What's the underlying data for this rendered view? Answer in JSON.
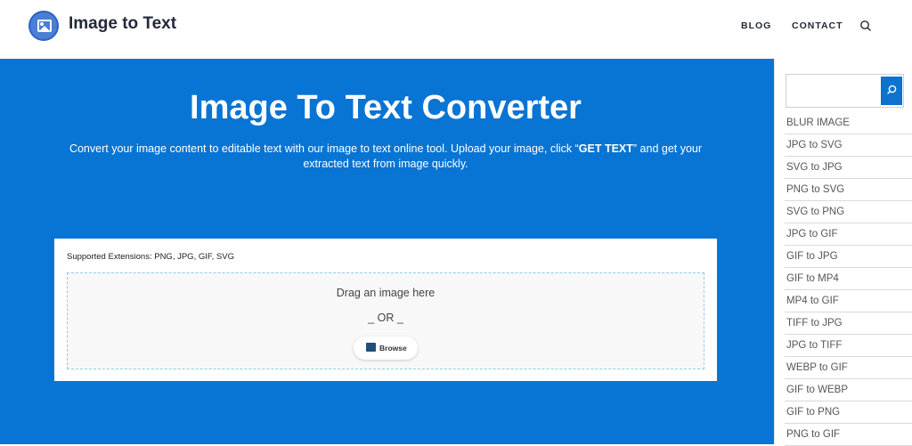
{
  "header": {
    "logo_text": "Image to Text",
    "nav": {
      "blog": "BLOG",
      "contact": "CONTACT"
    }
  },
  "hero": {
    "title": "Image To Text Converter",
    "desc_before": "Convert your image content to editable text with our image to text online tool. Upload your image, click “",
    "desc_bold": "GET TEXT",
    "desc_after": "” and get your extracted text from image quickly."
  },
  "card": {
    "extensions": "Supported Extensions: PNG, JPG, GIF, SVG",
    "drag_text": "Drag an image here",
    "or_text": "_ OR _",
    "browse_label": "Browse"
  },
  "sidebar": {
    "search_value": "",
    "items": [
      "BLUR IMAGE",
      "JPG to SVG",
      "SVG to JPG",
      "PNG to SVG",
      "SVG to PNG",
      "JPG to GIF",
      "GIF to JPG",
      "GIF to MP4",
      "MP4 to GIF",
      "TIFF to JPG",
      "JPG to TIFF",
      "WEBP to GIF",
      "GIF to WEBP",
      "GIF to PNG",
      "PNG to GIF"
    ]
  },
  "colors": {
    "hero_bg": "#0874d4",
    "accent": "#0c73d1",
    "text_dark": "#222a38"
  }
}
